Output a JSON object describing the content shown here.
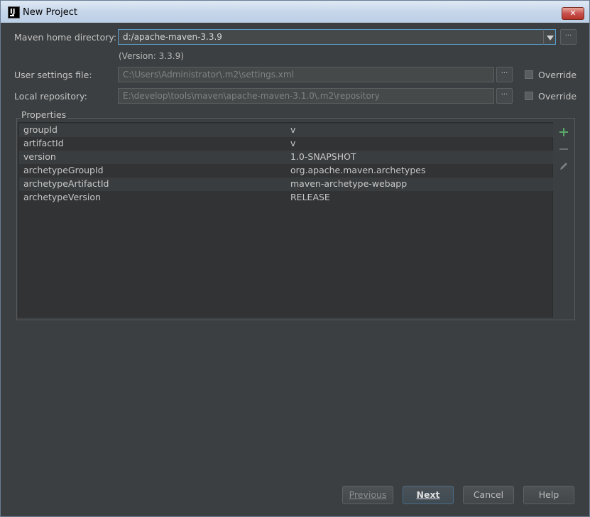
{
  "window": {
    "title": "New Project",
    "close_glyph": "✕"
  },
  "maven_home": {
    "label": "Maven home directory:",
    "value": "d:/apache-maven-3.3.9",
    "version_text": "(Version: 3.3.9)"
  },
  "user_settings": {
    "label": "User settings file:",
    "value": "C:\\Users\\Administrator\\.m2\\settings.xml",
    "override_label": "Override"
  },
  "local_repo": {
    "label": "Local repository:",
    "value": "E:\\develop\\tools\\maven\\apache-maven-3.1.0\\.m2\\repository",
    "override_label": "Override"
  },
  "browse_label": "···",
  "properties": {
    "title": "Properties",
    "rows": [
      {
        "key": "groupId",
        "value": "v"
      },
      {
        "key": "artifactId",
        "value": "v"
      },
      {
        "key": "version",
        "value": "1.0-SNAPSHOT"
      },
      {
        "key": "archetypeGroupId",
        "value": "org.apache.maven.archetypes"
      },
      {
        "key": "archetypeArtifactId",
        "value": "maven-archetype-webapp"
      },
      {
        "key": "archetypeVersion",
        "value": "RELEASE"
      }
    ]
  },
  "toolbar_icons": [
    "add-icon",
    "remove-icon",
    "edit-icon"
  ],
  "buttons": {
    "previous": "Previous",
    "next": "Next",
    "cancel": "Cancel",
    "help": "Help"
  },
  "colors": {
    "background": "#3c3f41",
    "focus_border": "#5a9ecf",
    "add_green": "#59a869"
  }
}
